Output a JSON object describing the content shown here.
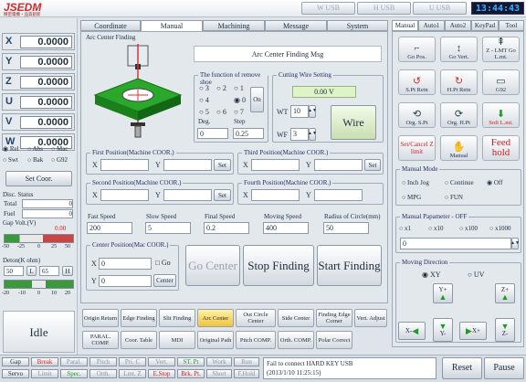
{
  "header": {
    "logo": "JSEDM",
    "logo_sub": "精密電機・品質創新",
    "usb": [
      "W USB",
      "H USB",
      "U USB"
    ],
    "clock": "13:44:43"
  },
  "axes": [
    {
      "label": "X",
      "value": "0.0000"
    },
    {
      "label": "Y",
      "value": "0.0000"
    },
    {
      "label": "Z",
      "value": "0.0000"
    },
    {
      "label": "U",
      "value": "0.0000"
    },
    {
      "label": "V",
      "value": "0.0000"
    },
    {
      "label": "W",
      "value": "0.0000"
    }
  ],
  "coord_radios": [
    "Rel",
    "Abs",
    "Mac",
    "Swt",
    "Bak",
    "G92"
  ],
  "set_coor": "Set Coor.",
  "disc_status": {
    "title": "Disc. Status",
    "total_label": "Total",
    "total_value": "0",
    "fuel_label": "Fuel",
    "fuel_value": "0"
  },
  "gap_volt": {
    "title": "Gap Volt.(V)",
    "value": "0.00",
    "scale": [
      "-50",
      "-25",
      "0",
      "25",
      "50"
    ]
  },
  "deton": {
    "title": "Deton(K ohm)",
    "left_value": "50",
    "l": "L",
    "right_value": "65",
    "h": "H",
    "scale": [
      "-20",
      "-10",
      "0",
      "10",
      "20"
    ]
  },
  "status": "Idle",
  "main_tabs": [
    "Coordinate",
    "Manual",
    "Machining",
    "Message",
    "System"
  ],
  "right_tabs": [
    "Manual",
    "Auto1",
    "Auto2",
    "KeyPad",
    "Tool"
  ],
  "acf": {
    "title": "Arc Center Finding",
    "banner": "Arc Center Finding Msg",
    "func_title": "The function of remove shoe",
    "radios": [
      "3",
      "2",
      "1",
      "4",
      "0",
      "5",
      "6",
      "7"
    ],
    "on_label": "On",
    "deg_label": "Deg.",
    "deg_value": "0",
    "step_label": "Step",
    "step_value": "0.25",
    "cut_title": "Cutting Wire Setting",
    "voltage": "0.00 V",
    "wt_label": "WT",
    "wt_value": "10",
    "wf_label": "WF",
    "wf_value": "3",
    "wire_btn": "Wire",
    "p1_title": "First Position(Machine COOR.)",
    "p2_title": "Second Position(Machine COOR.)",
    "p3_title": "Third Position(Machine COOR.)",
    "p4_title": "Fourth Position(Machine COOR.)",
    "x": "X",
    "y": "Y",
    "set": "Set",
    "fast_label": "Fast Speed",
    "fast_value": "200",
    "slow_label": "Slow Speed",
    "slow_value": "5",
    "final_label": "Final Speed",
    "final_value": "0.2",
    "moving_label": "Moving Speed",
    "moving_value": "400",
    "radius_label": "Radius of Circle(mm)",
    "radius_value": "50",
    "center_title": "Center Position(Mac COOR.)",
    "cx_value": "0",
    "cy_value": "0",
    "go_label": "Go",
    "center_btn": "Center",
    "go_center": "Go Center",
    "stop_finding": "Stop Finding",
    "start_finding": "Start Finding"
  },
  "func_row1": [
    "Origin Return",
    "Edge Finding",
    "Slit Finding",
    "Arc Center",
    "Out Circle Center",
    "Side Center",
    "Finding Edge Corner",
    "Vert. Adjust"
  ],
  "func_row2": [
    "PARAL. COMP.",
    "Coor. Table",
    "MDI",
    "Original Path",
    "Pitch COMP.",
    "Orth. COMP.",
    "Polar Correct"
  ],
  "mbtns": [
    "Go Pos.",
    "Go Vert.",
    "Z - LMT Go L.mt.",
    "S.Pt Retn",
    "H.Pt Retn",
    "G92",
    "Org. S.Pt",
    "Org. H.Pt",
    "Soft L.mt.",
    "Set/Cancel Z limit",
    "Manual",
    "Feed hold"
  ],
  "manual_mode": {
    "title": "Manual Mode",
    "opts": [
      "Inch Jog",
      "Continue",
      "Off",
      "MPG",
      "FUN"
    ]
  },
  "manual_param": {
    "title": "Manual Papameter - OFF",
    "opts": [
      "x1",
      "x10",
      "x100",
      "x1000"
    ],
    "value": "0"
  },
  "moving_dir": {
    "title": "Moving Direction",
    "opts": [
      "XY",
      "UV"
    ],
    "btns": [
      "Y+",
      "Z+",
      "X-",
      "X+",
      "Y-",
      "Z-"
    ]
  },
  "bottom_row1": [
    "Gap",
    "Break",
    "Paral.",
    "Pitch",
    "Pri. C",
    "Vert.",
    "ST. Pt",
    "Work",
    "Run"
  ],
  "bottom_row2": [
    "Servo",
    "Limit",
    "Spec.",
    "Orth.",
    "Lmt. Z",
    "E.Stop",
    "Brk. Pt.",
    "Short",
    "F.Hold"
  ],
  "message": [
    "Fail to connect HARD KEY USB",
    "(2013/1/10  11:25:15)"
  ],
  "reset": "Reset",
  "pause": "Pause",
  "colors": {
    "accent": "#e23b3b",
    "green": "#1f9a2a",
    "panel": "#e3e8ed"
  }
}
